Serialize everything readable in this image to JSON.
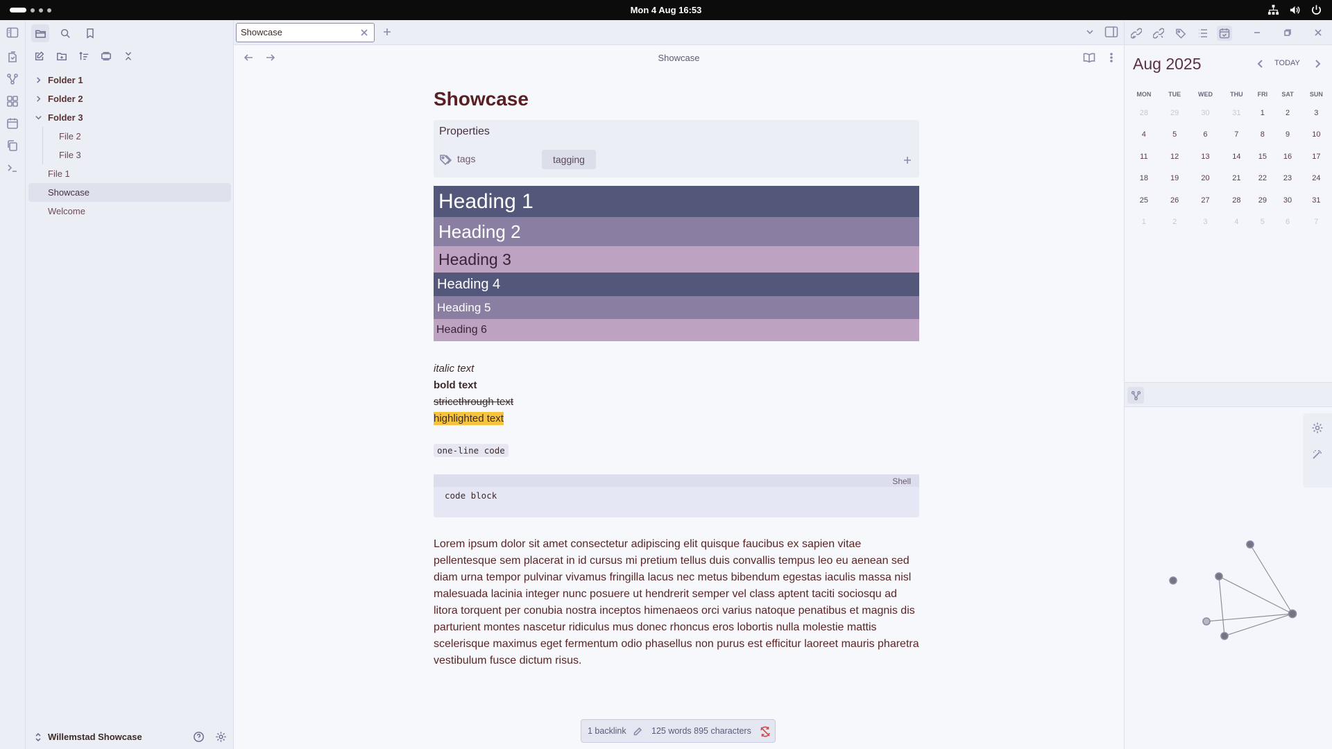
{
  "system": {
    "clock": "Mon 4 Aug  16:53"
  },
  "ribbon": {
    "icons": [
      "sidebar-toggle-icon",
      "file-pages-icon",
      "graph-icon",
      "canvas-icon",
      "calendar-icon",
      "copy-icon",
      "terminal-icon"
    ]
  },
  "explorer": {
    "tree": [
      {
        "type": "folder",
        "label": "Folder 1",
        "open": false
      },
      {
        "type": "folder",
        "label": "Folder 2",
        "open": false
      },
      {
        "type": "folder",
        "label": "Folder 3",
        "open": true
      },
      {
        "type": "child",
        "label": "File 2"
      },
      {
        "type": "child",
        "label": "File 3"
      },
      {
        "type": "file",
        "label": "File 1"
      },
      {
        "type": "file",
        "label": "Showcase",
        "selected": true
      },
      {
        "type": "file",
        "label": "Welcome"
      }
    ],
    "vault_name": "Willemstad Showcase"
  },
  "tab": {
    "title": "Showcase"
  },
  "breadcrumb": "Showcase",
  "note": {
    "title": "Showcase",
    "properties_label": "Properties",
    "tag_key": "tags",
    "tag_value": "tagging",
    "headings": [
      "Heading 1",
      "Heading 2",
      "Heading 3",
      "Heading 4",
      "Heading 5",
      "Heading 6"
    ],
    "italic": "italic text",
    "bold": "bold text",
    "strike": "stricethrough text",
    "highlight": "highlighted text",
    "inline_code": "one-line code",
    "code_lang": "Shell",
    "code_block": "code block",
    "lorem": "Lorem ipsum dolor sit amet consectetur adipiscing elit quisque faucibus ex sapien vitae pellentesque sem placerat in id cursus mi pretium tellus duis convallis tempus leo eu aenean sed diam urna tempor pulvinar vivamus fringilla lacus nec metus bibendum egestas iaculis massa nisl malesuada lacinia integer nunc posuere ut hendrerit semper vel class aptent taciti sociosqu ad litora torquent per conubia nostra inceptos himenaeos orci varius natoque penatibus et magnis dis parturient montes nascetur ridiculus mus donec rhoncus eros lobortis nulla molestie mattis scelerisque maximus eget fermentum odio phasellus non purus est efficitur laoreet mauris pharetra vestibulum fusce dictum risus."
  },
  "status": {
    "backlinks": "1 backlink",
    "counts": "125 words 895 characters"
  },
  "calendar": {
    "month": "Aug 2025",
    "today_label": "TODAY",
    "weekdays": [
      "MON",
      "TUE",
      "WED",
      "THU",
      "FRI",
      "SAT",
      "SUN"
    ],
    "weeks": [
      [
        [
          "28",
          true
        ],
        [
          "29",
          true
        ],
        [
          "30",
          true
        ],
        [
          "31",
          true
        ],
        [
          "1",
          false
        ],
        [
          "2",
          false
        ],
        [
          "3",
          false
        ]
      ],
      [
        [
          "4",
          false
        ],
        [
          "5",
          false
        ],
        [
          "6",
          false
        ],
        [
          "7",
          false
        ],
        [
          "8",
          false
        ],
        [
          "9",
          false
        ],
        [
          "10",
          false
        ]
      ],
      [
        [
          "11",
          false
        ],
        [
          "12",
          false
        ],
        [
          "13",
          false
        ],
        [
          "14",
          false
        ],
        [
          "15",
          false
        ],
        [
          "16",
          false
        ],
        [
          "17",
          false
        ]
      ],
      [
        [
          "18",
          false
        ],
        [
          "19",
          false
        ],
        [
          "20",
          false
        ],
        [
          "21",
          false
        ],
        [
          "22",
          false
        ],
        [
          "23",
          false
        ],
        [
          "24",
          false
        ]
      ],
      [
        [
          "25",
          false
        ],
        [
          "26",
          false
        ],
        [
          "27",
          false
        ],
        [
          "28",
          false
        ],
        [
          "29",
          false
        ],
        [
          "30",
          false
        ],
        [
          "31",
          false
        ]
      ],
      [
        [
          "1",
          true
        ],
        [
          "2",
          true
        ],
        [
          "3",
          true
        ],
        [
          "4",
          true
        ],
        [
          "5",
          true
        ],
        [
          "6",
          true
        ],
        [
          "7",
          true
        ]
      ]
    ]
  },
  "colors": {
    "heading_dark": "#535779",
    "heading_mid": "#8a7fa2",
    "heading_light": "#bea2c1",
    "highlight": "#f6c43c",
    "title": "#5a1f22"
  }
}
